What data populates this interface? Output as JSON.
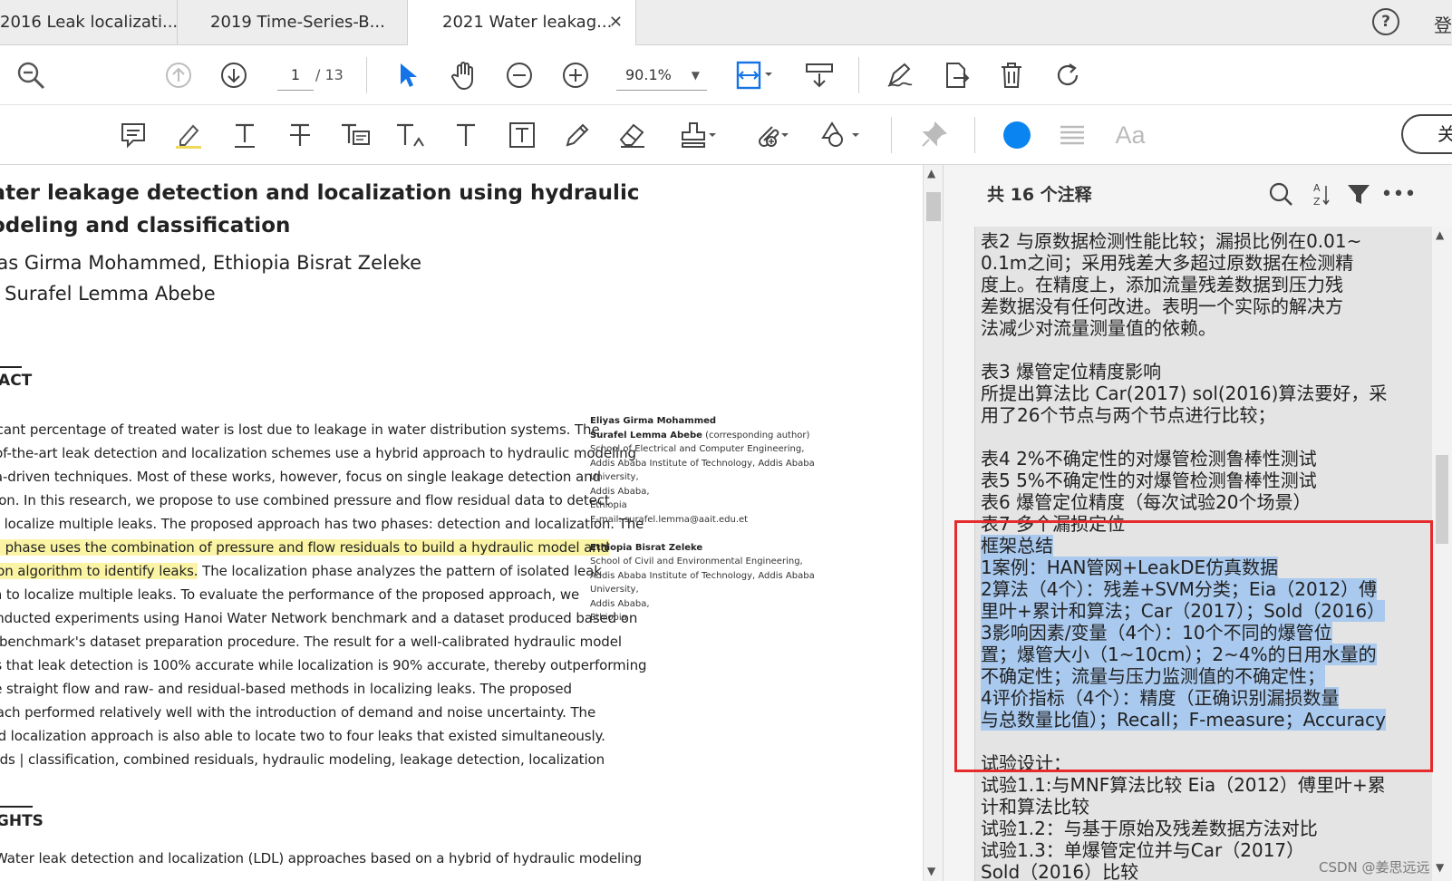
{
  "tabs": [
    {
      "label": "2016 Leak localizati...",
      "active": false
    },
    {
      "label": "2019 Time-Series-B...",
      "active": false
    },
    {
      "label": "2021 Water leakag...",
      "active": true
    }
  ],
  "header": {
    "help_icon": "?",
    "login_label": "登"
  },
  "toolbar": {
    "page_current": "1",
    "page_total": "/ 13",
    "zoom": "90.1%",
    "close_label": "关闭",
    "color_swatch": "#0a84f0",
    "font_label": "Aa"
  },
  "document": {
    "title_lines": [
      "Water leakage detection and localization using hydraulic",
      "modeling and classification"
    ],
    "author_lines": [
      "Eliyas Girma Mohammed, Ethiopia Bisrat Zeleke",
      "and Surafel Lemma Abebe"
    ],
    "abstract_heading": "ABSTRACT",
    "abstract_lines": [
      "A significant percentage of treated water is lost due to leakage in water distribution systems. The",
      "state-of-the-art leak detection and localization schemes use a hybrid approach to hydraulic modeling",
      "and data-driven techniques. Most of these works, however, focus on single leakage detection and",
      "localization. In this research, we propose to use combined pressure and flow residual data to detect",
      "and localize multiple leaks. The proposed approach has two phases: detection and localization. The",
      "detection phase uses the combination of pressure and flow residuals to build a hydraulic model and",
      "classification algorithm to identify leaks.",
      "leaks and use the pattern to localize multiple leaks. To evaluate the performance of the proposed approach, we",
      "conducted experiments using Hanoi Water Network benchmark and a dataset produced based on",
      "the benchmark's dataset preparation procedure. The result for a well-calibrated hydraulic model",
      "shows that leak detection is 100% accurate while localization is 90% accurate, thereby outperforming",
      "the straight flow and raw- and residual-based methods in localizing leaks. The proposed",
      "approach performed relatively well with the introduction of demand and noise uncertainty. The",
      "proposed localization approach is also able to locate two to four leaks that existed simultaneously.",
      "Key words | classification, combined residuals, hydraulic modeling, leakage detection, localization"
    ],
    "abstract_line7_tail": " The localization phase analyzes the pattern of isolated leak",
    "highlights_heading": "HIGHLIGHTS",
    "highlights_line": "Water leak detection and localization (LDL) approaches based on a hybrid of hydraulic modeling",
    "affiliations": [
      {
        "bold": "Eliyas Girma Mohammed",
        "rest": ""
      },
      {
        "bold": "Surafel Lemma Abebe",
        "rest": " (corresponding author)"
      },
      {
        "bold": "",
        "rest": "School of Electrical and Computer Engineering,"
      },
      {
        "bold": "",
        "rest": "Addis Ababa Institute of Technology, Addis Ababa"
      },
      {
        "bold": "",
        "rest": "   University,"
      },
      {
        "bold": "",
        "rest": "Addis Ababa,"
      },
      {
        "bold": "",
        "rest": "Ethiopia"
      },
      {
        "bold": "",
        "rest": "E-mail: surafel.lemma@aait.edu.et"
      },
      {
        "bold": "",
        "rest": ""
      },
      {
        "bold": "Ethiopia Bisrat Zeleke",
        "rest": ""
      },
      {
        "bold": "",
        "rest": "School of Civil and Environmental Engineering,"
      },
      {
        "bold": "",
        "rest": "Addis Ababa Institute of Technology, Addis Ababa"
      },
      {
        "bold": "",
        "rest": "   University,"
      },
      {
        "bold": "",
        "rest": "Addis Ababa,"
      },
      {
        "bold": "",
        "rest": "Ethiopia"
      }
    ]
  },
  "comments": {
    "count_label": "共 16 个注释",
    "note_lines": [
      {
        "text": "表2 与原数据检测性能比较；漏损比例在0.01~",
        "selected": false
      },
      {
        "text": "0.1m之间；采用残差大多超过原数据在检测精",
        "selected": false
      },
      {
        "text": "度上。在精度上，添加流量残差数据到压力残",
        "selected": false
      },
      {
        "text": "差数据没有任何改进。表明一个实际的解决方",
        "selected": false
      },
      {
        "text": "法减少对流量测量值的依赖。",
        "selected": false
      },
      {
        "text": "",
        "selected": false
      },
      {
        "text": "表3 爆管定位精度影响",
        "selected": false
      },
      {
        "text": "所提出算法比 Car(2017) sol(2016)算法要好，采",
        "selected": false
      },
      {
        "text": "用了26个节点与两个节点进行比较；",
        "selected": false
      },
      {
        "text": "",
        "selected": false
      },
      {
        "text": "表4 2%不确定性的对爆管检测鲁棒性测试",
        "selected": false
      },
      {
        "text": "表5 5%不确定性的对爆管检测鲁棒性测试",
        "selected": false
      },
      {
        "text": "表6 爆管定位精度（每次试验20个场景）",
        "selected": false
      },
      {
        "text": "表7 多个漏损定位",
        "selected": false
      },
      {
        "text": "框架总结",
        "selected": true
      },
      {
        "text": "1案例：HAN管网+LeakDE仿真数据",
        "selected": true
      },
      {
        "text": "2算法（4个）：残差+SVM分类；Eia（2012）傅",
        "selected": true
      },
      {
        "text": "里叶+累计和算法；Car（2017）；Sold（2016）",
        "selected": true
      },
      {
        "text": "3影响因素/变量（4个）：10个不同的爆管位",
        "selected": true
      },
      {
        "text": "置；爆管大小（1~10cm）；2~4%的日用水量的",
        "selected": true
      },
      {
        "text": "不确定性；流量与压力监测值的不确定性；",
        "selected": true
      },
      {
        "text": "4评价指标（4个）：精度（正确识别漏损数量",
        "selected": true
      },
      {
        "text": "与总数量比值）；Recall；F-measure；Accuracy",
        "selected": true
      },
      {
        "text": "",
        "selected": false
      },
      {
        "text": "试验设计：",
        "selected": false
      },
      {
        "text": "试验1.1:与MNF算法比较 Eia（2012）傅里叶+累",
        "selected": false
      },
      {
        "text": "计和算法比较",
        "selected": false
      },
      {
        "text": "试验1.2：与基于原始及残差数据方法对比",
        "selected": false
      },
      {
        "text": "试验1.3：单爆管定位并与Car（2017）",
        "selected": false
      },
      {
        "text": "Sold（2016）比较",
        "selected": false
      }
    ]
  },
  "watermark": "CSDN @姜思远远"
}
